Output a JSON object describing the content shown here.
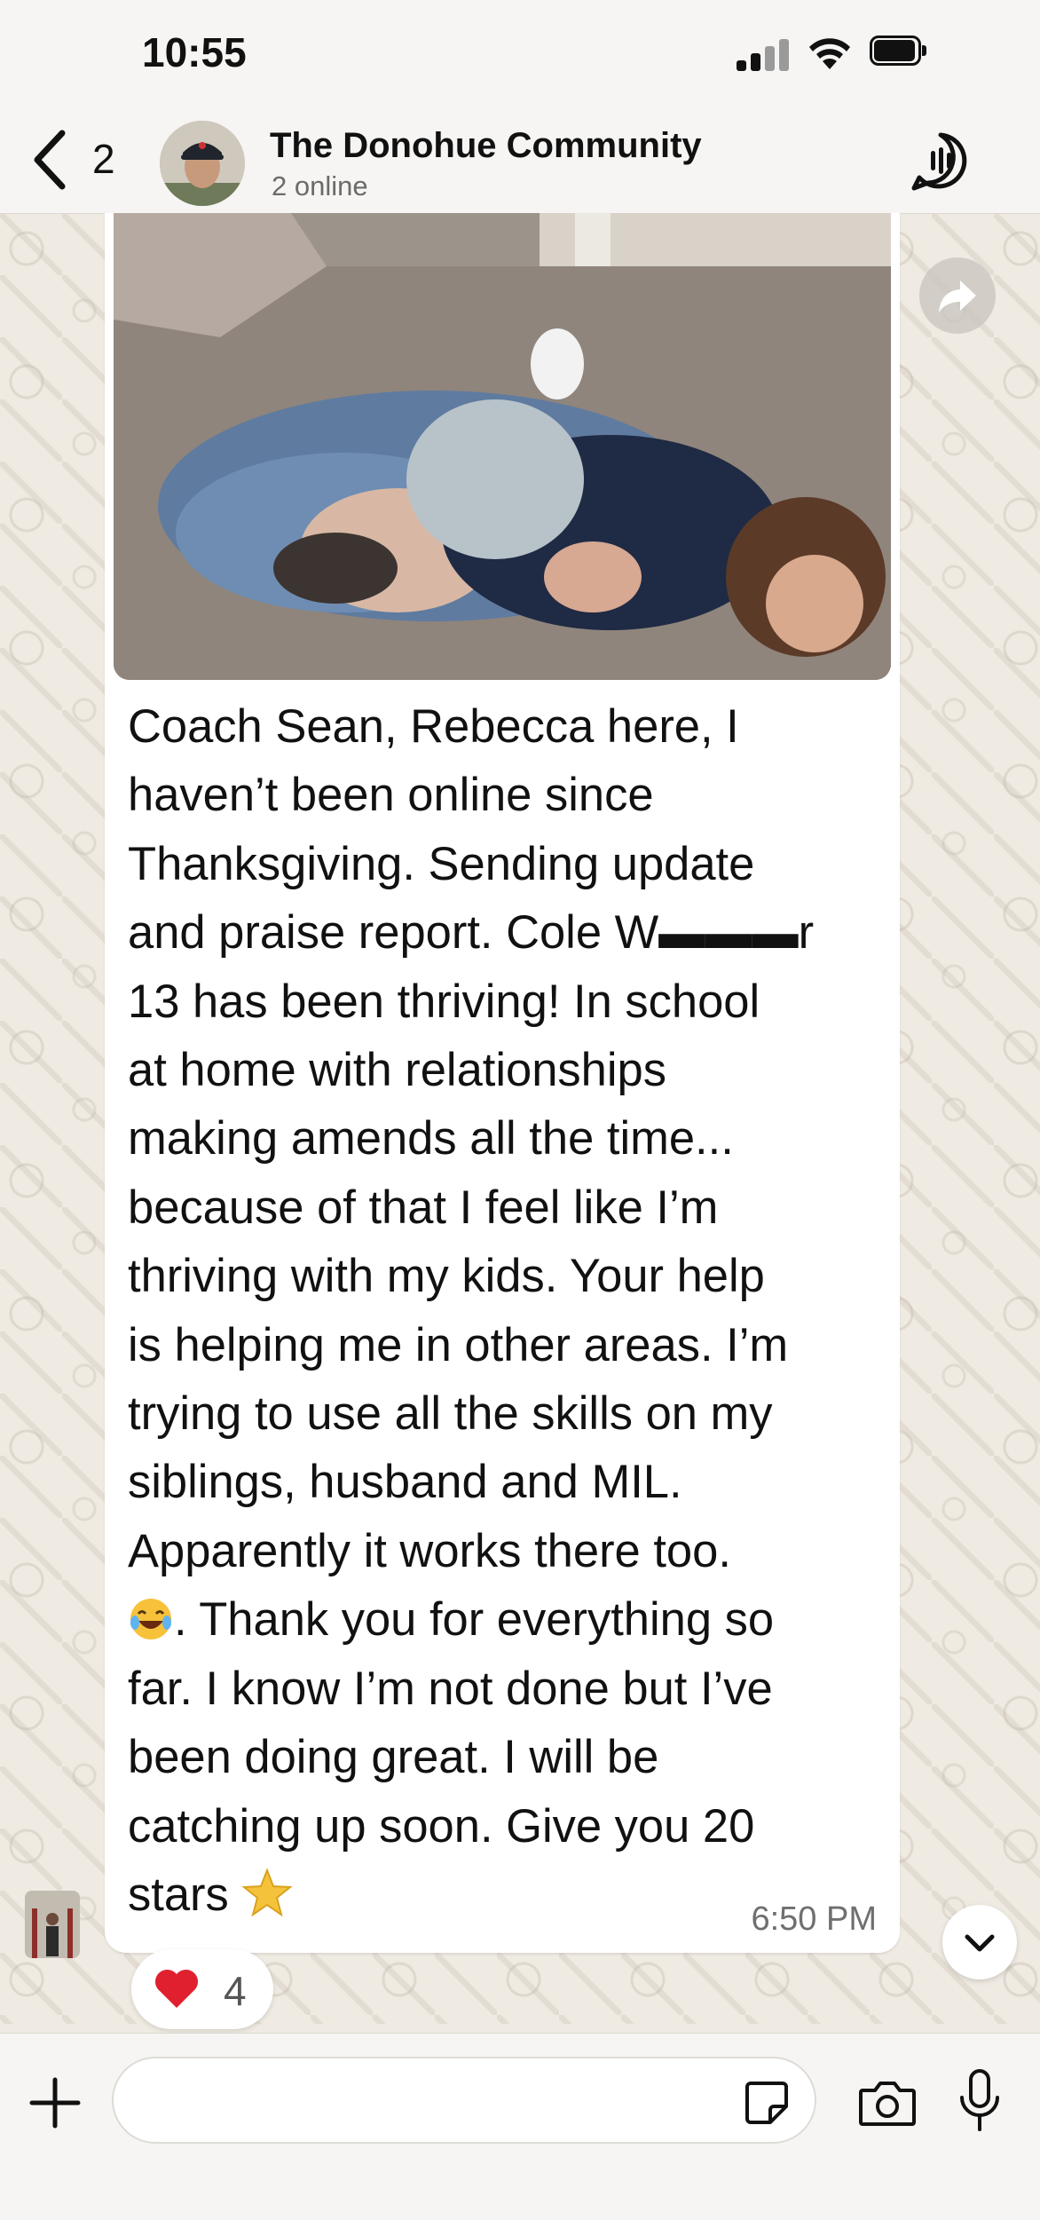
{
  "status_bar": {
    "time": "10:55"
  },
  "header": {
    "back_count": "2",
    "title": "The Donohue Community",
    "subtitle": "2 online"
  },
  "message": {
    "text_before_emoji": "Coach Sean, Rebecca here, I\nhaven’t been online since\nThanksgiving.  Sending update\nand praise report. Cole W▬▬▬r\n13 has been thriving!  In school\nat home with relationships\nmaking amends all the time...\nbecause of that I feel like I’m\nthriving with my kids.  Your help\nis helping me in other areas. I’m\ntrying to use all the skills on my\nsiblings, husband and MIL.\nApparently it works there too.\n",
    "text_after_emoji": ". Thank you for everything so\nfar.  I know I’m not done but I’ve\nbeen doing great.  I will be\ncatching up soon. Give you 20\nstars ",
    "time": "6:50 PM"
  },
  "reaction": {
    "emoji": "heart",
    "count": "4"
  },
  "composer": {
    "placeholder": ""
  },
  "icons": {
    "back": "chevron-left-icon",
    "community": "community-icon",
    "forward": "forward-icon",
    "scroll": "chevron-down-icon",
    "plus": "plus-icon",
    "sticker": "sticker-icon",
    "camera": "camera-icon",
    "mic": "microphone-icon"
  },
  "colors": {
    "wallpaper": "#efeae2",
    "bubble": "#ffffff",
    "reaction_heart": "#e0202e"
  }
}
